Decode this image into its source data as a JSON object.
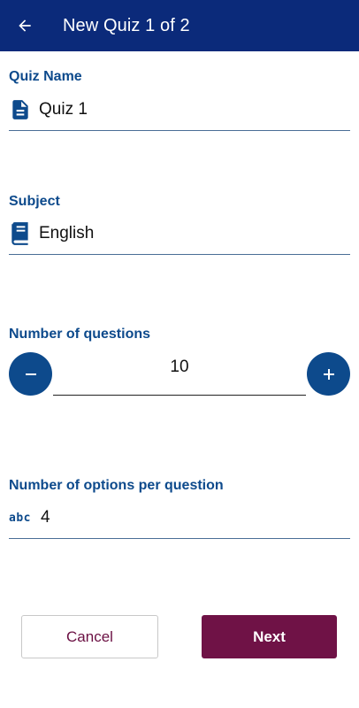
{
  "appbar": {
    "title": "New Quiz 1 of 2",
    "back_icon": "arrow-left-icon"
  },
  "quiz_name": {
    "label": "Quiz Name",
    "value": "Quiz 1",
    "icon": "document-icon"
  },
  "subject": {
    "label": "Subject",
    "value": "English",
    "icon": "book-icon"
  },
  "num_questions": {
    "label": "Number of questions",
    "value": "10",
    "decrement_icon": "minus-icon",
    "increment_icon": "plus-icon"
  },
  "num_options": {
    "label": "Number of options per question",
    "value": "4",
    "icon_text": "abc"
  },
  "actions": {
    "cancel_label": "Cancel",
    "next_label": "Next"
  },
  "colors": {
    "appbar": "#0b2a7a",
    "accent": "#0d4a8c",
    "primary_button": "#6f1246",
    "cancel_text": "#6b1043"
  }
}
